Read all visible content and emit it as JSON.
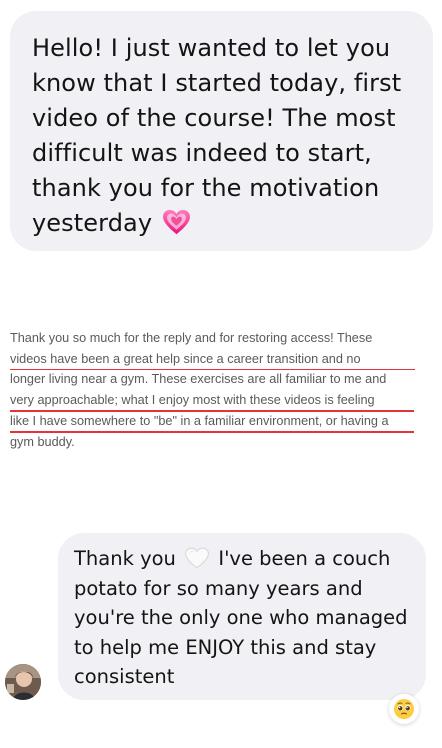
{
  "messages": {
    "top": {
      "text": "Hello! I just wanted to let you know that I started today, first video of the course! The most difficult was indeed to start, thank you for the motivation yesterday",
      "emoji": "growing-heart-icon"
    },
    "bottom": {
      "text_before": "Thank you",
      "text_after": "I've been a couch potato for so many years and you're the only one who managed to help me ENJOY this and stay consistent",
      "emoji": "white-heart-icon",
      "reaction": "pleading-face-icon"
    }
  },
  "review": {
    "lines": [
      "Thank you so much for the reply and for restoring access! These",
      "videos have been a great help since a career transition and no",
      "longer living near a gym. These exercises are all familiar to me and",
      "very approachable; what I enjoy most with these videos is feeling",
      "like I have somewhere to \"be\" in a familiar environment, or having a",
      "gym buddy."
    ],
    "underline_color": "#e2343a"
  },
  "colors": {
    "bubble_bg": "#f0f0f5",
    "text_dark": "#141414",
    "review_text": "#5a5a5a",
    "heart_pink": "#f0529a"
  }
}
